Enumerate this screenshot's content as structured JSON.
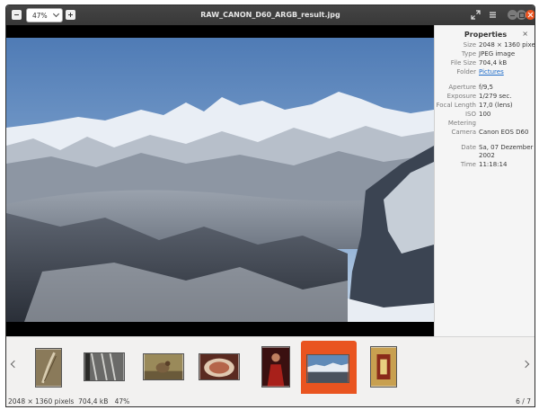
{
  "titlebar": {
    "title": "RAW_CANON_D60_ARGB_result.jpg",
    "zoom": "47%"
  },
  "properties": {
    "heading": "Properties",
    "close": "×",
    "rows": [
      {
        "key": "Size",
        "value": "2048 × 1360 pixels"
      },
      {
        "key": "Type",
        "value": "JPEG image"
      },
      {
        "key": "File Size",
        "value": "704,4 kB"
      },
      {
        "key": "Folder",
        "value": "Pictures"
      },
      {
        "key": "Aperture",
        "value": "f/9,5"
      },
      {
        "key": "Exposure",
        "value": "1/279 sec."
      },
      {
        "key": "Focal Length",
        "value": "17,0 (lens)"
      },
      {
        "key": "ISO",
        "value": "100"
      },
      {
        "key": "Metering",
        "value": ""
      },
      {
        "key": "Camera",
        "value": "Canon EOS D60"
      },
      {
        "key": "Date",
        "value": "Sa, 07 Dezember"
      },
      {
        "key": "",
        "value": "2002"
      },
      {
        "key": "Time",
        "value": "11:18:14"
      }
    ]
  },
  "thumbnails": [
    {
      "subject": "feather",
      "color": "#8a7a5a"
    },
    {
      "subject": "metal bars",
      "color": "#6a6a68"
    },
    {
      "subject": "bird",
      "color": "#9a8a5a"
    },
    {
      "subject": "food plate",
      "color": "#b5654a"
    },
    {
      "subject": "red figure",
      "color": "#a8201a"
    },
    {
      "subject": "mountain landscape",
      "color": "#5f8ab8"
    },
    {
      "subject": "shrine",
      "color": "#c8a050"
    }
  ],
  "selected_index": 5,
  "statusbar": {
    "dimensions": "2048 × 1360 pixels",
    "filesize": "704,4 kB",
    "zoom": "47%",
    "position": "6 / 7"
  },
  "colors": {
    "accent": "#e95420",
    "titlebar": "#3c3c3c",
    "link": "#1b6ac9"
  }
}
